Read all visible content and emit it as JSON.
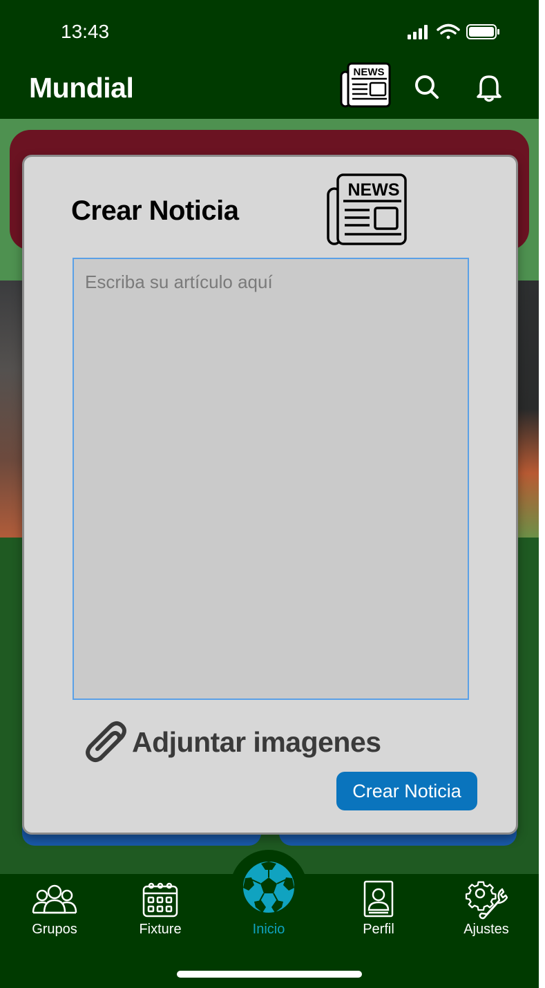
{
  "status_bar": {
    "time": "13:43"
  },
  "header": {
    "title": "Mundial",
    "news_icon_text": "NEWS"
  },
  "modal": {
    "title": "Crear Noticia",
    "news_icon_text": "NEWS",
    "article_placeholder": "Escriba su artículo aquí",
    "article_value": "",
    "attach_label": "Adjuntar imagenes",
    "submit_label": "Crear Noticia"
  },
  "bottom_nav": {
    "items": [
      {
        "label": "Grupos",
        "icon": "group-icon"
      },
      {
        "label": "Fixture",
        "icon": "calendar-icon"
      },
      {
        "label": "Inicio",
        "icon": "soccer-ball-icon",
        "active": true
      },
      {
        "label": "Perfil",
        "icon": "profile-icon"
      },
      {
        "label": "Ajustes",
        "icon": "settings-icon"
      }
    ],
    "active_color": "#10a3c0"
  },
  "colors": {
    "header_bg": "#003a00",
    "modal_bg": "#d7d7d7",
    "button_bg": "#0a74bd",
    "textarea_border": "#5aa0e6"
  }
}
